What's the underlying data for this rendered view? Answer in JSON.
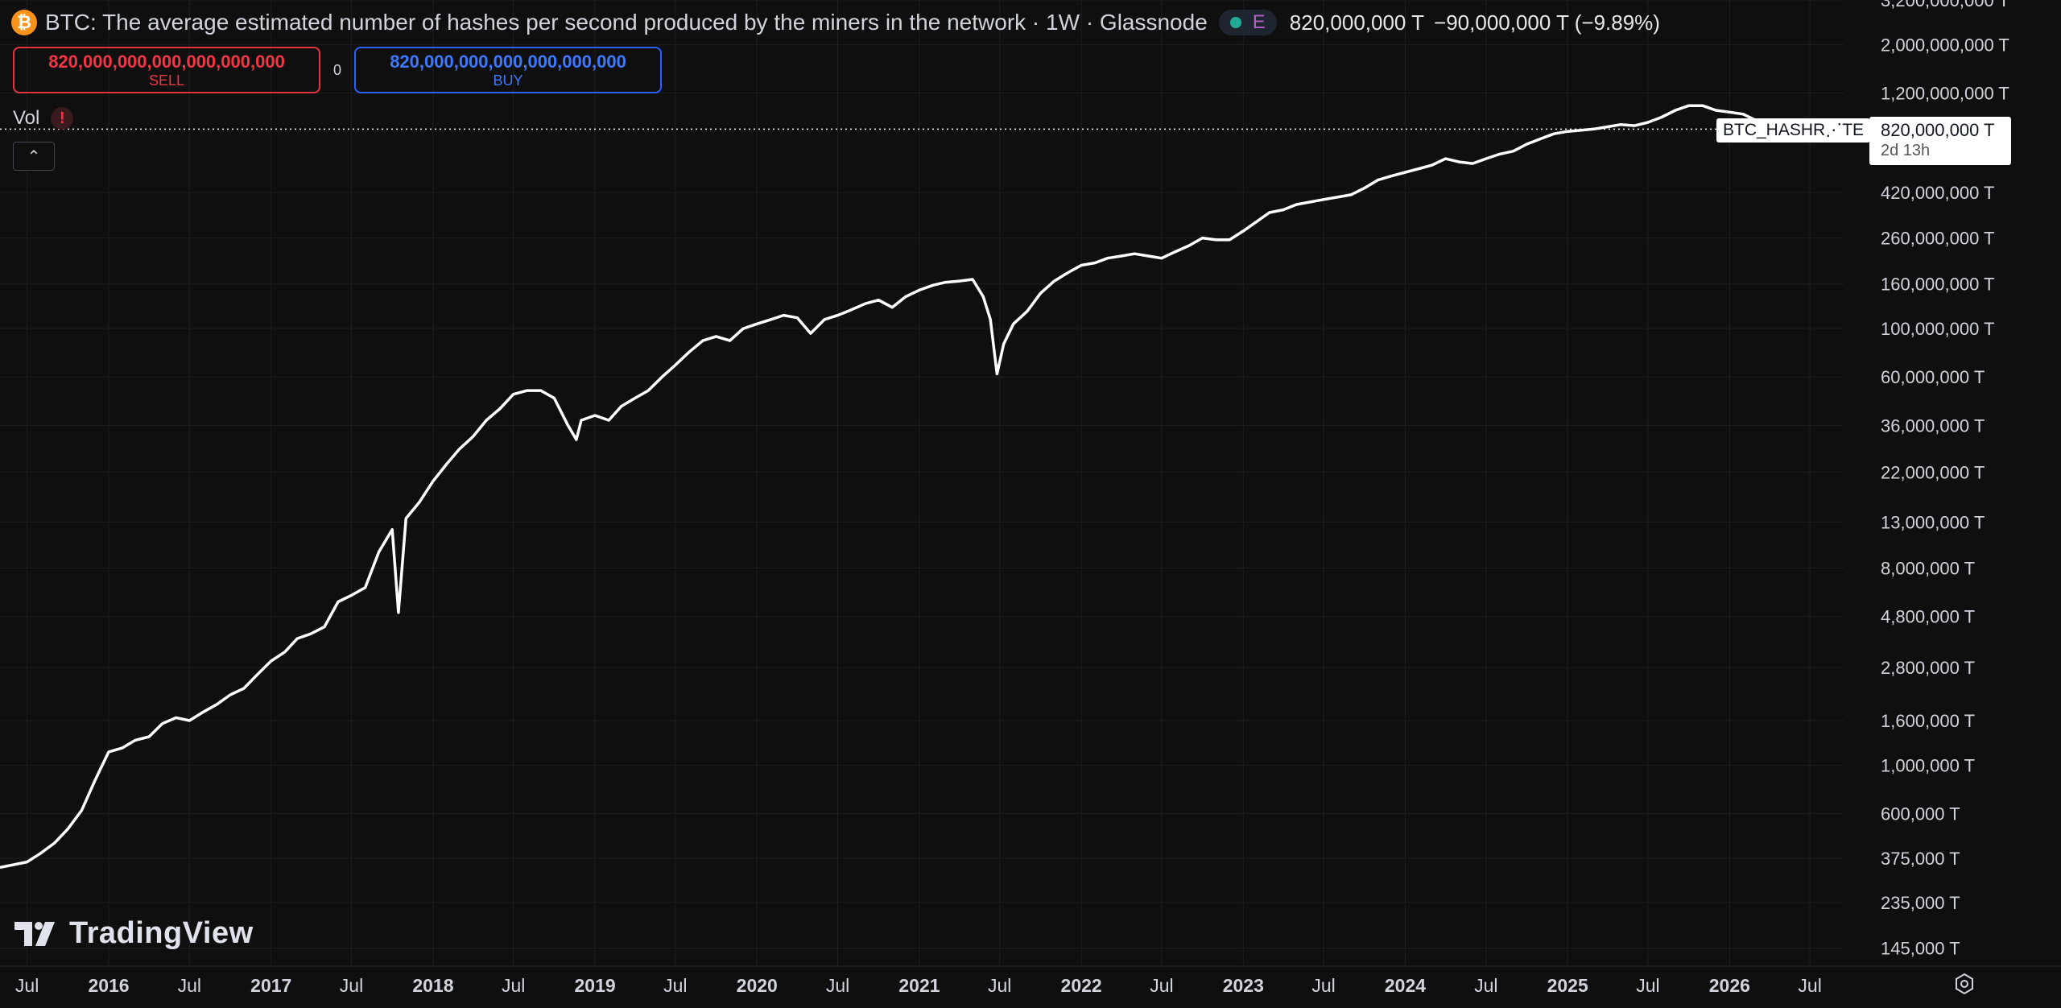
{
  "header": {
    "symbol_icon": "bitcoin-icon",
    "symbol_glyph": "₿",
    "title": "BTC: The average estimated number of hashes per second produced by the miners in the network · 1W · Glassnode",
    "status_badge": "E",
    "last_value": "820,000,000 T",
    "change": "−90,000,000 T (−9.89%)"
  },
  "trade": {
    "sell_price": "820,000,000,000,000,000,000",
    "sell_label": "SELL",
    "spread": "0",
    "buy_price": "820,000,000,000,000,000,000",
    "buy_label": "BUY"
  },
  "volume": {
    "label": "Vol",
    "warning_glyph": "!"
  },
  "collapse": {
    "glyph": "⌃"
  },
  "price_scale": {
    "symbol_tag": "BTC_HASHR⋰TE",
    "last_price": "820,000,000 T",
    "countdown": "2d 13h"
  },
  "watermark": {
    "name": "TradingView"
  },
  "colors": {
    "background": "#0f0f0f",
    "line": "#ffffff",
    "grid": "#1f1f1f",
    "sell": "#f23645",
    "buy": "#2962ff",
    "axis_text": "#d1d4dc"
  },
  "chart_data": {
    "type": "line",
    "title": "BTC: The average estimated number of hashes per second produced by the miners in the network",
    "interval": "1W",
    "source": "Glassnode",
    "y_unit": "T",
    "y_scale": "log",
    "ylim": [
      120000,
      3200000000
    ],
    "xlim": [
      "2015-05-01",
      "2026-09-15"
    ],
    "grid": true,
    "y_ticks": [
      {
        "value": 3200000000,
        "label": "3,200,000,000 T"
      },
      {
        "value": 2000000000,
        "label": "2,000,000,000 T"
      },
      {
        "value": 1200000000,
        "label": "1,200,000,000 T"
      },
      {
        "value": 420000000,
        "label": "420,000,000 T"
      },
      {
        "value": 260000000,
        "label": "260,000,000 T"
      },
      {
        "value": 160000000,
        "label": "160,000,000 T"
      },
      {
        "value": 100000000,
        "label": "100,000,000 T"
      },
      {
        "value": 60000000,
        "label": "60,000,000 T"
      },
      {
        "value": 36000000,
        "label": "36,000,000 T"
      },
      {
        "value": 22000000,
        "label": "22,000,000 T"
      },
      {
        "value": 13000000,
        "label": "13,000,000 T"
      },
      {
        "value": 8000000,
        "label": "8,000,000 T"
      },
      {
        "value": 4800000,
        "label": "4,800,000 T"
      },
      {
        "value": 2800000,
        "label": "2,800,000 T"
      },
      {
        "value": 1600000,
        "label": "1,600,000 T"
      },
      {
        "value": 1000000,
        "label": "1,000,000 T"
      },
      {
        "value": 600000,
        "label": "600,000 T"
      },
      {
        "value": 375000,
        "label": "375,000 T"
      },
      {
        "value": 235000,
        "label": "235,000 T"
      },
      {
        "value": 145000,
        "label": "145,000 T"
      }
    ],
    "x_ticks": [
      {
        "date": "2015-07-01",
        "label": "Jul",
        "bold": false
      },
      {
        "date": "2016-01-01",
        "label": "2016",
        "bold": true
      },
      {
        "date": "2016-07-01",
        "label": "Jul",
        "bold": false
      },
      {
        "date": "2017-01-01",
        "label": "2017",
        "bold": true
      },
      {
        "date": "2017-07-01",
        "label": "Jul",
        "bold": false
      },
      {
        "date": "2018-01-01",
        "label": "2018",
        "bold": true
      },
      {
        "date": "2018-07-01",
        "label": "Jul",
        "bold": false
      },
      {
        "date": "2019-01-01",
        "label": "2019",
        "bold": true
      },
      {
        "date": "2019-07-01",
        "label": "Jul",
        "bold": false
      },
      {
        "date": "2020-01-01",
        "label": "2020",
        "bold": true
      },
      {
        "date": "2020-07-01",
        "label": "Jul",
        "bold": false
      },
      {
        "date": "2021-01-01",
        "label": "2021",
        "bold": true
      },
      {
        "date": "2021-07-01",
        "label": "Jul",
        "bold": false
      },
      {
        "date": "2022-01-01",
        "label": "2022",
        "bold": true
      },
      {
        "date": "2022-07-01",
        "label": "Jul",
        "bold": false
      },
      {
        "date": "2023-01-01",
        "label": "2023",
        "bold": true
      },
      {
        "date": "2023-07-01",
        "label": "Jul",
        "bold": false
      },
      {
        "date": "2024-01-01",
        "label": "2024",
        "bold": true
      },
      {
        "date": "2024-07-01",
        "label": "Jul",
        "bold": false
      },
      {
        "date": "2025-01-01",
        "label": "2025",
        "bold": true
      },
      {
        "date": "2025-07-01",
        "label": "Jul",
        "bold": false
      },
      {
        "date": "2026-01-01",
        "label": "2026",
        "bold": true
      },
      {
        "date": "2026-07-01",
        "label": "Jul",
        "bold": false
      }
    ],
    "series": [
      {
        "name": "BTC_HASHRATE",
        "points": [
          [
            "2015-05-01",
            340000
          ],
          [
            "2015-06-01",
            350000
          ],
          [
            "2015-07-01",
            360000
          ],
          [
            "2015-08-01",
            395000
          ],
          [
            "2015-09-01",
            440000
          ],
          [
            "2015-10-01",
            510000
          ],
          [
            "2015-11-01",
            620000
          ],
          [
            "2015-12-01",
            850000
          ],
          [
            "2016-01-01",
            1150000
          ],
          [
            "2016-02-01",
            1200000
          ],
          [
            "2016-03-01",
            1300000
          ],
          [
            "2016-04-01",
            1350000
          ],
          [
            "2016-05-01",
            1550000
          ],
          [
            "2016-06-01",
            1650000
          ],
          [
            "2016-07-01",
            1600000
          ],
          [
            "2016-08-01",
            1750000
          ],
          [
            "2016-09-01",
            1900000
          ],
          [
            "2016-10-01",
            2100000
          ],
          [
            "2016-11-01",
            2250000
          ],
          [
            "2016-12-01",
            2600000
          ],
          [
            "2017-01-01",
            3000000
          ],
          [
            "2017-02-01",
            3300000
          ],
          [
            "2017-03-01",
            3800000
          ],
          [
            "2017-04-01",
            4000000
          ],
          [
            "2017-05-01",
            4300000
          ],
          [
            "2017-06-01",
            5600000
          ],
          [
            "2017-07-01",
            6000000
          ],
          [
            "2017-08-01",
            6500000
          ],
          [
            "2017-09-01",
            9500000
          ],
          [
            "2017-10-01",
            12000000
          ],
          [
            "2017-10-15",
            5000000
          ],
          [
            "2017-11-01",
            13500000
          ],
          [
            "2017-12-01",
            16000000
          ],
          [
            "2018-01-01",
            20000000
          ],
          [
            "2018-02-01",
            24000000
          ],
          [
            "2018-03-01",
            28000000
          ],
          [
            "2018-04-01",
            32000000
          ],
          [
            "2018-05-01",
            38000000
          ],
          [
            "2018-06-01",
            43000000
          ],
          [
            "2018-07-01",
            50000000
          ],
          [
            "2018-08-01",
            52000000
          ],
          [
            "2018-09-01",
            52000000
          ],
          [
            "2018-10-01",
            48000000
          ],
          [
            "2018-11-01",
            36000000
          ],
          [
            "2018-11-20",
            31000000
          ],
          [
            "2018-12-01",
            38000000
          ],
          [
            "2019-01-01",
            40000000
          ],
          [
            "2019-02-01",
            38000000
          ],
          [
            "2019-03-01",
            44000000
          ],
          [
            "2019-04-01",
            48000000
          ],
          [
            "2019-05-01",
            52000000
          ],
          [
            "2019-06-01",
            60000000
          ],
          [
            "2019-07-01",
            68000000
          ],
          [
            "2019-08-01",
            78000000
          ],
          [
            "2019-09-01",
            88000000
          ],
          [
            "2019-10-01",
            92000000
          ],
          [
            "2019-11-01",
            88000000
          ],
          [
            "2019-12-01",
            100000000
          ],
          [
            "2020-01-01",
            105000000
          ],
          [
            "2020-02-01",
            110000000
          ],
          [
            "2020-03-01",
            115000000
          ],
          [
            "2020-04-01",
            112000000
          ],
          [
            "2020-05-01",
            95000000
          ],
          [
            "2020-06-01",
            110000000
          ],
          [
            "2020-07-01",
            115000000
          ],
          [
            "2020-08-01",
            122000000
          ],
          [
            "2020-09-01",
            130000000
          ],
          [
            "2020-10-01",
            135000000
          ],
          [
            "2020-11-01",
            125000000
          ],
          [
            "2020-12-01",
            140000000
          ],
          [
            "2021-01-01",
            150000000
          ],
          [
            "2021-02-01",
            158000000
          ],
          [
            "2021-03-01",
            163000000
          ],
          [
            "2021-04-01",
            165000000
          ],
          [
            "2021-05-01",
            168000000
          ],
          [
            "2021-05-25",
            140000000
          ],
          [
            "2021-06-10",
            110000000
          ],
          [
            "2021-06-25",
            62000000
          ],
          [
            "2021-07-10",
            85000000
          ],
          [
            "2021-08-01",
            105000000
          ],
          [
            "2021-09-01",
            120000000
          ],
          [
            "2021-10-01",
            145000000
          ],
          [
            "2021-11-01",
            165000000
          ],
          [
            "2021-12-01",
            180000000
          ],
          [
            "2022-01-01",
            195000000
          ],
          [
            "2022-02-01",
            200000000
          ],
          [
            "2022-03-01",
            210000000
          ],
          [
            "2022-04-01",
            215000000
          ],
          [
            "2022-05-01",
            220000000
          ],
          [
            "2022-06-01",
            215000000
          ],
          [
            "2022-07-01",
            210000000
          ],
          [
            "2022-08-01",
            225000000
          ],
          [
            "2022-09-01",
            240000000
          ],
          [
            "2022-10-01",
            260000000
          ],
          [
            "2022-11-01",
            255000000
          ],
          [
            "2022-12-01",
            255000000
          ],
          [
            "2023-01-01",
            280000000
          ],
          [
            "2023-02-01",
            310000000
          ],
          [
            "2023-03-01",
            340000000
          ],
          [
            "2023-04-01",
            350000000
          ],
          [
            "2023-05-01",
            370000000
          ],
          [
            "2023-06-01",
            380000000
          ],
          [
            "2023-07-01",
            390000000
          ],
          [
            "2023-08-01",
            400000000
          ],
          [
            "2023-09-01",
            410000000
          ],
          [
            "2023-10-01",
            440000000
          ],
          [
            "2023-11-01",
            480000000
          ],
          [
            "2023-12-01",
            500000000
          ],
          [
            "2024-01-01",
            520000000
          ],
          [
            "2024-02-01",
            540000000
          ],
          [
            "2024-03-01",
            560000000
          ],
          [
            "2024-04-01",
            600000000
          ],
          [
            "2024-05-01",
            580000000
          ],
          [
            "2024-06-01",
            570000000
          ],
          [
            "2024-07-01",
            600000000
          ],
          [
            "2024-08-01",
            630000000
          ],
          [
            "2024-09-01",
            650000000
          ],
          [
            "2024-10-01",
            700000000
          ],
          [
            "2024-11-01",
            740000000
          ],
          [
            "2024-12-01",
            780000000
          ],
          [
            "2025-01-01",
            800000000
          ],
          [
            "2025-02-01",
            810000000
          ],
          [
            "2025-03-01",
            820000000
          ],
          [
            "2025-04-01",
            840000000
          ],
          [
            "2025-05-01",
            860000000
          ],
          [
            "2025-06-01",
            850000000
          ],
          [
            "2025-07-01",
            880000000
          ],
          [
            "2025-08-01",
            930000000
          ],
          [
            "2025-09-01",
            1000000000
          ],
          [
            "2025-10-01",
            1050000000
          ],
          [
            "2025-11-01",
            1050000000
          ],
          [
            "2025-12-01",
            1000000000
          ],
          [
            "2026-01-01",
            980000000
          ],
          [
            "2026-02-01",
            960000000
          ],
          [
            "2026-03-01",
            900000000
          ],
          [
            "2026-04-01",
            880000000
          ],
          [
            "2026-04-20",
            820000000
          ]
        ]
      }
    ],
    "last_value": 820000000
  }
}
